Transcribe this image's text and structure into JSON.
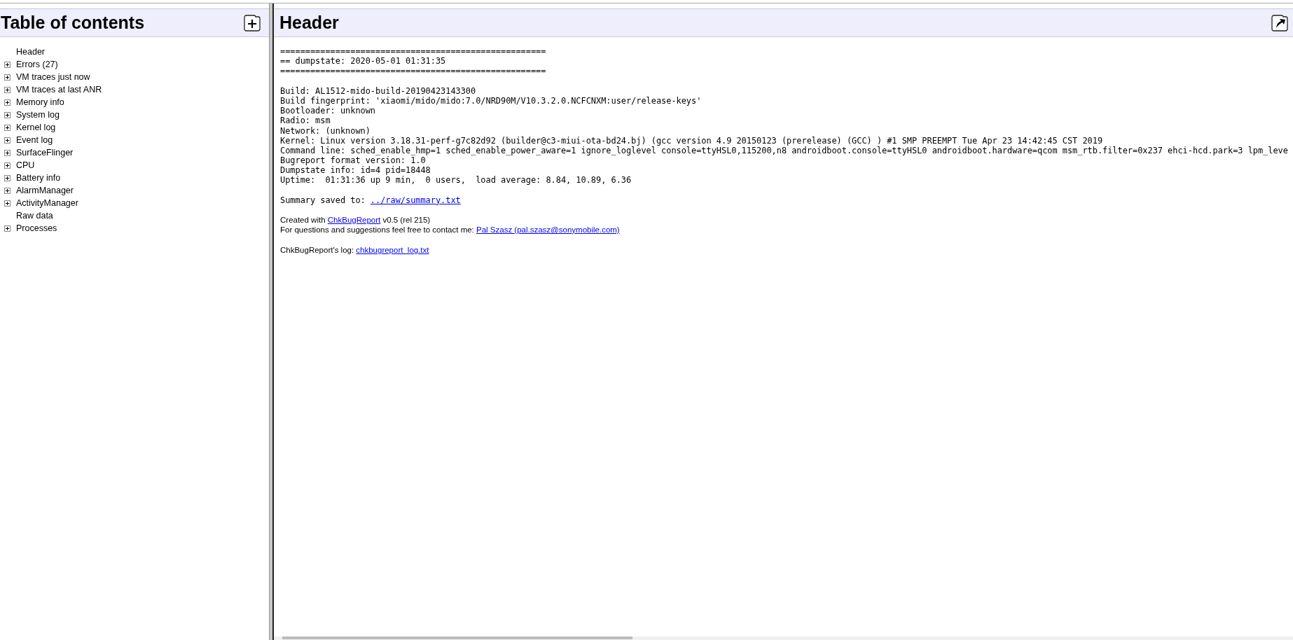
{
  "toc": {
    "title": "Table of contents",
    "items": [
      {
        "label": "Header"
      },
      {
        "label": "Errors (27)",
        "expanded": false
      },
      {
        "label": "VM traces just now",
        "expanded": false
      },
      {
        "label": "VM traces at last ANR",
        "expanded": false
      },
      {
        "label": "Memory info",
        "expanded": false
      },
      {
        "label": "System log",
        "expanded": false
      },
      {
        "label": "Kernel log",
        "expanded": false
      },
      {
        "label": "Event log",
        "expanded": false
      },
      {
        "label": "SurfaceFlinger",
        "expanded": false
      },
      {
        "label": "CPU",
        "expanded": false
      },
      {
        "label": "Battery info",
        "expanded": false
      },
      {
        "label": "AlarmManager",
        "expanded": false
      },
      {
        "label": "ActivityManager",
        "expanded": false
      },
      {
        "label": "Raw data"
      },
      {
        "label": "Processes",
        "expanded": false
      }
    ]
  },
  "content": {
    "title": "Header",
    "banner_lines": [
      "=====================================================",
      "== dumpstate: 2020-05-01 01:31:35",
      "====================================================="
    ],
    "dump_lines": [
      "Build: AL1512-mido-build-20190423143300",
      "Build fingerprint: 'xiaomi/mido/mido:7.0/NRD90M/V10.3.2.0.NCFCNXM:user/release-keys'",
      "Bootloader: unknown",
      "Radio: msm",
      "Network: (unknown)",
      "Kernel: Linux version 3.18.31-perf-g7c82d92 (builder@c3-miui-ota-bd24.bj) (gcc version 4.9 20150123 (prerelease) (GCC) ) #1 SMP PREEMPT Tue Apr 23 14:42:45 CST 2019",
      "Command line: sched_enable_hmp=1 sched_enable_power_aware=1 ignore_loglevel console=ttyHSL0,115200,n8 androidboot.console=ttyHSL0 androidboot.hardware=qcom msm_rtb.filter=0x237 ehci-hcd.park=3 lpm_leve",
      "Bugreport format version: 1.0",
      "Dumpstate info: id=4 pid=18448",
      "Uptime:  01:31:36 up 9 min,  0 users,  load average: 8.84, 10.89, 6.36"
    ],
    "summary": {
      "text": "Summary saved to: ",
      "link": "../raw/summary.txt"
    },
    "credits": [
      {
        "before": "Created with ",
        "link": "ChkBugReport",
        "after": " v0.5 (rel 215)"
      },
      {
        "before": "For questions and suggestions feel free to contact me: ",
        "link": "Pal Szasz (pal.szasz@sonymobile.com)"
      }
    ],
    "log": {
      "before": "ChkBugReport's log: ",
      "link": "chkbugreport_log.txt"
    }
  }
}
